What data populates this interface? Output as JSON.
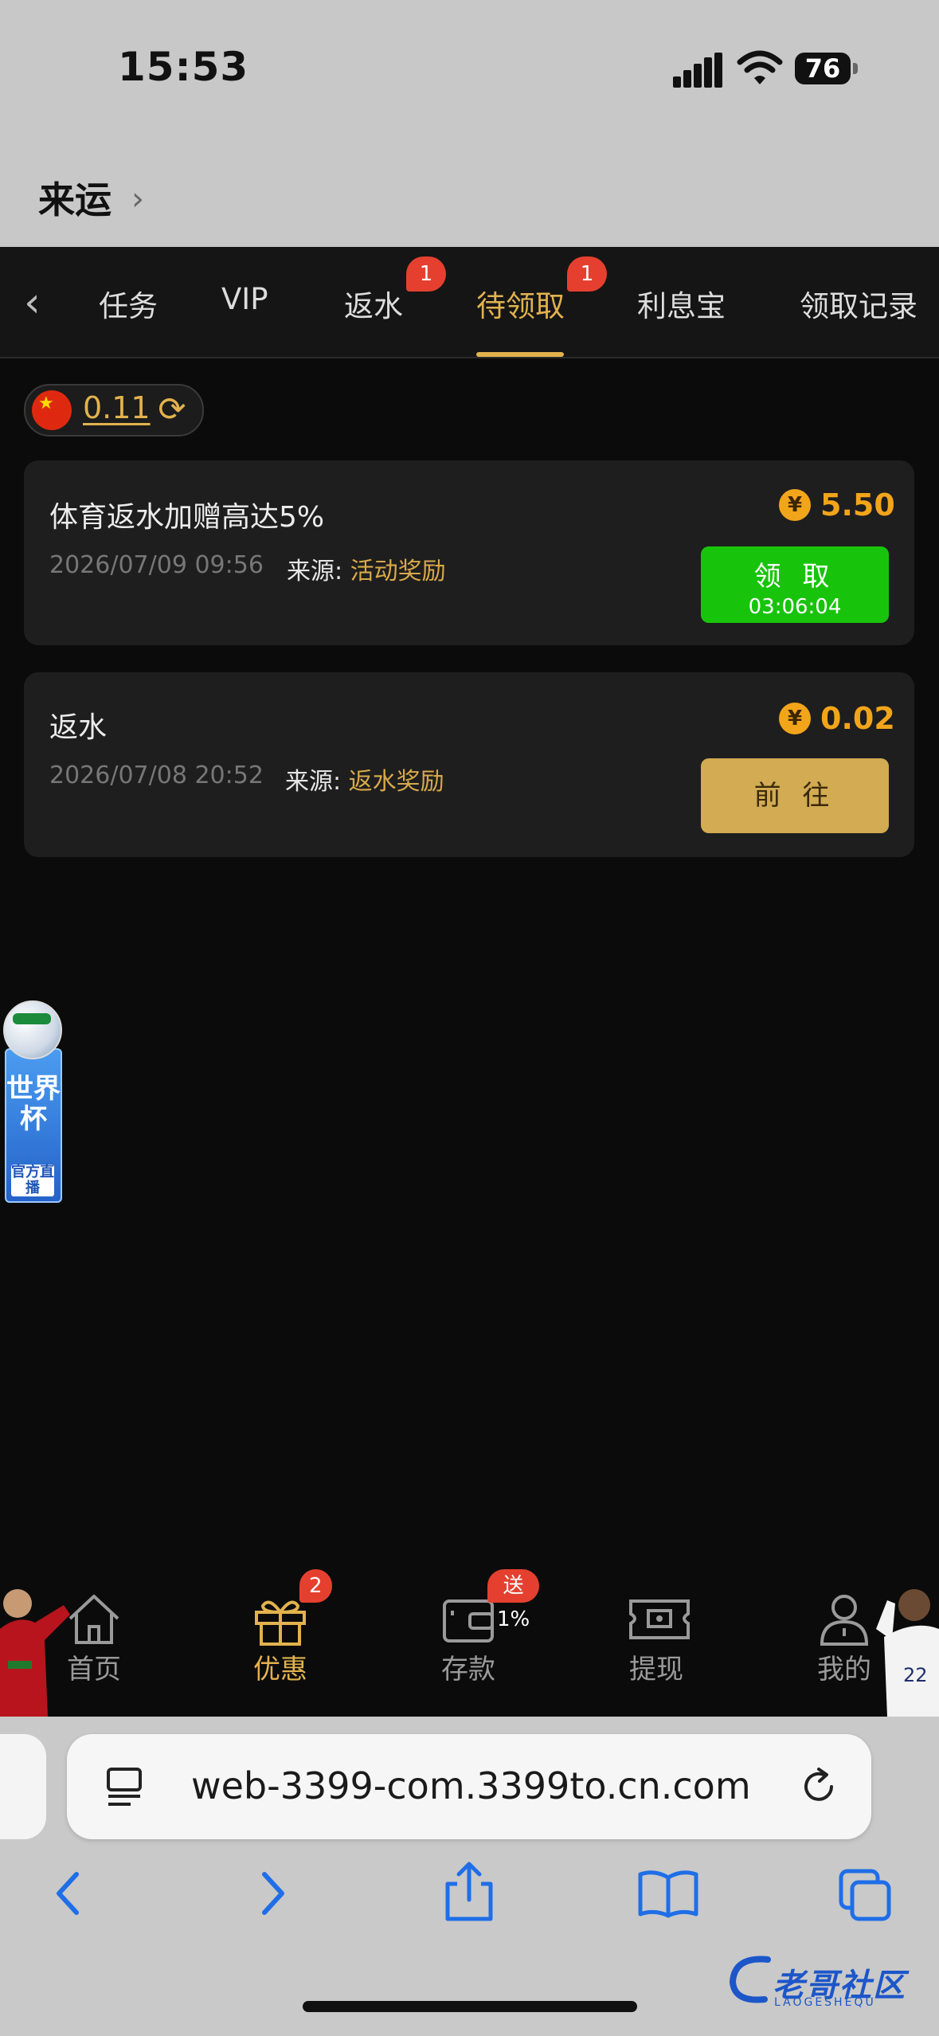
{
  "status": {
    "time": "15:53",
    "battery": "76"
  },
  "header": {
    "title": "来运"
  },
  "tabs": [
    {
      "label": "任务",
      "badge": ""
    },
    {
      "label": "VIP",
      "badge": ""
    },
    {
      "label": "返水",
      "badge": "1"
    },
    {
      "label": "待领取",
      "badge": "1"
    },
    {
      "label": "利息宝",
      "badge": ""
    },
    {
      "label": "领取记录",
      "badge": ""
    }
  ],
  "balance": {
    "value": "0.11"
  },
  "rewards": [
    {
      "title": "体育返水加赠高达5%",
      "date": "2026/07/09 09:56",
      "source_label": "来源:",
      "source": "活动奖励",
      "coin": "¥",
      "amount": "5.50",
      "button_label": "领 取",
      "countdown": "03:06:04"
    },
    {
      "title": "返水",
      "date": "2026/07/08 20:52",
      "source_label": "来源:",
      "source": "返水奖励",
      "coin": "¥",
      "amount": "0.02",
      "button_label": "前 往"
    }
  ],
  "floating_badge": {
    "title": "世界杯",
    "subtitle": "官方直播"
  },
  "bottom_nav": [
    {
      "label": "首页",
      "badge": ""
    },
    {
      "label": "优惠",
      "badge": "2"
    },
    {
      "label": "存款",
      "badge": "送1%"
    },
    {
      "label": "提现",
      "badge": ""
    },
    {
      "label": "我的",
      "badge": ""
    }
  ],
  "browser": {
    "url": "web-3399-com.3399to.cn.com"
  },
  "watermark": {
    "text": "老哥社区",
    "sub": "LAOGESHEQU"
  },
  "colors": {
    "accent": "#e2b24e",
    "claim_green": "#18c40b",
    "go_gold": "#d2ab52",
    "badge_red": "#e5402f",
    "coin_orange": "#f2a51a"
  }
}
